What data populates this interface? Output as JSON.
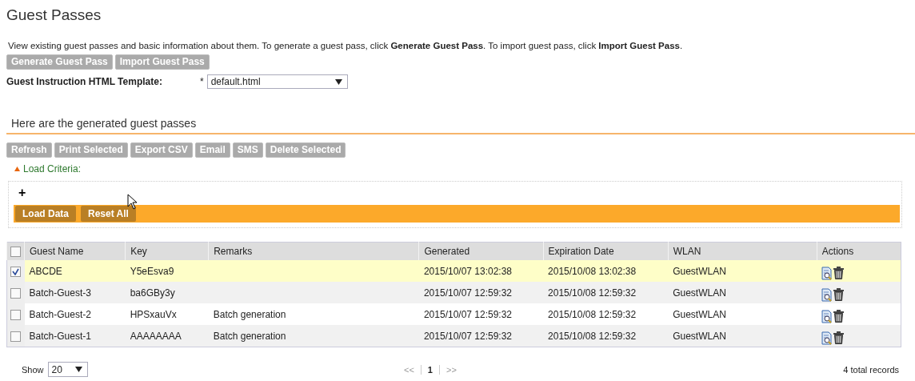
{
  "page_title": "Guest Passes",
  "description": "View existing guest passes and basic information about them. To generate a guest pass, click **Generate Guest Pass**. To import guest pass, click **Import Guest Pass**.",
  "top_buttons": [
    "Generate Guest Pass",
    "Import Guest Pass"
  ],
  "template": {
    "label": "Guest Instruction HTML Template:",
    "required_mark": "*",
    "value": "default.html"
  },
  "section_title": "Here are the generated guest passes",
  "toolbar_buttons": [
    "Refresh",
    "Print Selected",
    "Export CSV",
    "Email",
    "SMS",
    "Delete Selected"
  ],
  "load_criteria": {
    "label": "Load Criteria:",
    "expanded": true,
    "add": "+",
    "buttons": [
      "Load Data",
      "Reset All"
    ]
  },
  "table": {
    "select_all": {
      "checked": false
    },
    "columns": [
      "Guest Name",
      "Key",
      "Remarks",
      "Generated",
      "Expiration Date",
      "WLAN",
      "Actions"
    ],
    "rows": [
      {
        "selected": true,
        "cells": [
          "ABCDE",
          "Y5eEsva9",
          "",
          "2015/10/07 13:02:38",
          "2015/10/08 13:02:38",
          "GuestWLAN"
        ]
      },
      {
        "selected": false,
        "cells": [
          "Batch-Guest-3",
          "ba6GBy3y",
          "",
          "2015/10/07 12:59:32",
          "2015/10/08 12:59:32",
          "GuestWLAN"
        ]
      },
      {
        "selected": false,
        "cells": [
          "Batch-Guest-2",
          "HPSxauVx",
          "Batch generation",
          "2015/10/07 12:59:32",
          "2015/10/08 12:59:32",
          "GuestWLAN"
        ]
      },
      {
        "selected": false,
        "cells": [
          "Batch-Guest-1",
          "AAAAAAAA",
          "Batch generation",
          "2015/10/07 12:59:32",
          "2015/10/08 12:59:32",
          "GuestWLAN"
        ]
      }
    ]
  },
  "footer": {
    "show_label": "Show",
    "page_size": "20",
    "first": "<<",
    "page": "1",
    "next": ">>",
    "total": "4 total records"
  }
}
